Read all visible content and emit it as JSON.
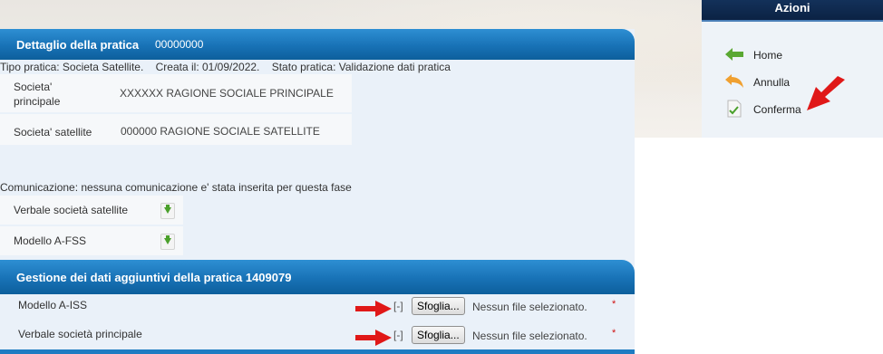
{
  "detail": {
    "title": "Dettaglio della pratica",
    "number": "00000000",
    "meta": "Tipo pratica: Societa Satellite.    Creata il: 01/09/2022.    Stato pratica: Validazione dati pratica",
    "fields": [
      {
        "label": "Societa' principale",
        "value": "XXXXXX RAGIONE SOCIALE PRINCIPALE"
      },
      {
        "label": "Societa' satellite",
        "value": "000000 RAGIONE SOCIALE SATELLITE"
      }
    ],
    "comunicazione": "Comunicazione: nessuna comunicazione e' stata inserita per questa fase",
    "documents": [
      {
        "label": "Verbale società satellite",
        "icon": "download-icon"
      },
      {
        "label": "Modello A-FSS",
        "icon": "download-icon"
      }
    ]
  },
  "extra": {
    "title": "Gestione dei dati aggiuntivi della pratica 1409079",
    "uploads": [
      {
        "label": "Modello A-ISS",
        "toggle": "[-]",
        "button": "Sfoglia...",
        "status": "Nessun file selezionato.",
        "required": "*"
      },
      {
        "label": "Verbale società principale",
        "toggle": "[-]",
        "button": "Sfoglia...",
        "status": "Nessun file selezionato.",
        "required": "*"
      }
    ]
  },
  "actions": {
    "title": "Azioni",
    "items": [
      {
        "label": "Home",
        "icon": "arrow-left-icon"
      },
      {
        "label": "Annulla",
        "icon": "undo-icon"
      },
      {
        "label": "Conferma",
        "icon": "document-check-icon"
      }
    ]
  },
  "colors": {
    "header_blue": "#1872b6",
    "panel_bg": "#eaf1f9",
    "azioni_head": "#0b2244",
    "arrow_red": "#e01818"
  }
}
